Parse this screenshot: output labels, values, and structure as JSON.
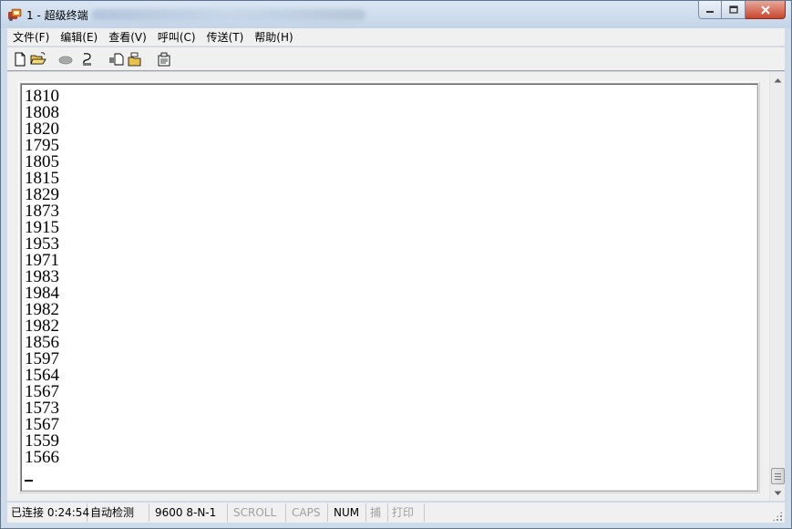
{
  "window": {
    "title": "1 - 超级终端"
  },
  "menu": {
    "items": [
      {
        "label": "文件(F)"
      },
      {
        "label": "编辑(E)"
      },
      {
        "label": "查看(V)"
      },
      {
        "label": "呼叫(C)"
      },
      {
        "label": "传送(T)"
      },
      {
        "label": "帮助(H)"
      }
    ]
  },
  "toolbar": {
    "icons": [
      "new-file-icon",
      "open-folder-icon",
      "disconnect-phone-icon",
      "call-icon",
      "send-file-icon",
      "receive-file-icon",
      "properties-icon"
    ]
  },
  "terminal": {
    "lines": [
      "1810",
      "1808",
      "1820",
      "1795",
      "1805",
      "1815",
      "1829",
      "1873",
      "1915",
      "1953",
      "1971",
      "1983",
      "1984",
      "1982",
      "1982",
      "1856",
      "1597",
      "1564",
      "1567",
      "1573",
      "1567",
      "1559",
      "1566"
    ]
  },
  "status": {
    "connection": "已连接 0:24:54",
    "detect": "自动检测",
    "port": "9600 8-N-1",
    "scroll": "SCROLL",
    "caps": "CAPS",
    "num": "NUM",
    "capture": "捕",
    "print": "打印"
  },
  "colors": {
    "titlebar": "#c3d4e8",
    "close_button": "#c7462d",
    "terminal_bg": "#ffffff"
  }
}
